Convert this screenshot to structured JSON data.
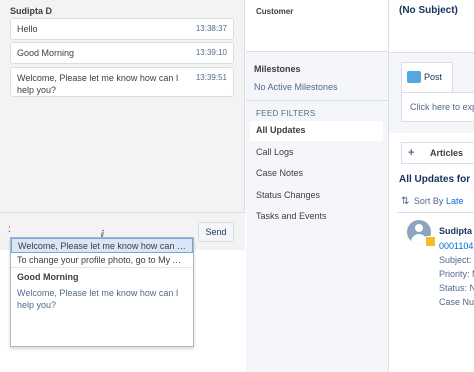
{
  "chat": {
    "agent_name": "Sudipta D",
    "messages": [
      {
        "text": "Hello",
        "time": "13:38:37"
      },
      {
        "text": "Good Morning",
        "time": "13:39:10"
      },
      {
        "text": "Welcome, Please let me know how can I help you?",
        "time": "13:39:51"
      }
    ],
    "input_value": ":",
    "send_label": "Send"
  },
  "suggestions": {
    "items": [
      "Welcome, Please let me know how can I h...",
      "To change your profile photo, go to My Acc..."
    ],
    "preview_title": "Good Morning",
    "preview_body": "Welcome, Please let me know how can I help you?"
  },
  "middle": {
    "customer_label": "Customer",
    "milestones_title": "Milestones",
    "milestones_empty": "No Active Milestones",
    "feed_filters_label": "FEED FILTERS",
    "filters": [
      "All Updates",
      "Call Logs",
      "Case Notes",
      "Status Changes",
      "Tasks and Events"
    ]
  },
  "right": {
    "subject": "(No Subject)",
    "post_label": "Post",
    "post_placeholder": "Click here to exp",
    "articles_label": "Articles",
    "updates_title": "All Updates for",
    "sort_label": "Sort By",
    "sort_value": "Late",
    "case_lines": [
      "Sudipta I",
      "0001104",
      "Subject:",
      "Priority: M",
      "Status: N",
      "Case Nu"
    ]
  },
  "colors": {
    "accent": "#0070d2",
    "post_icon": "#54a7e0",
    "badge": "#f4bc25",
    "selection": "#d8e6f8"
  }
}
